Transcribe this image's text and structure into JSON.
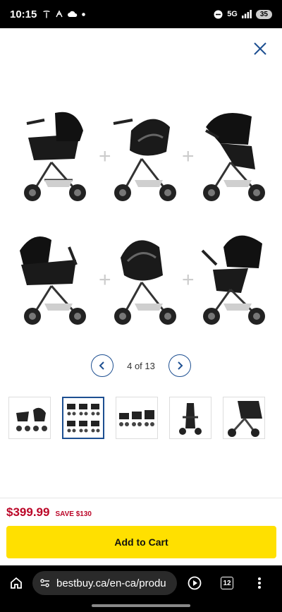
{
  "status_bar": {
    "time": "10:15",
    "signal_label": "5G",
    "battery": "35",
    "colors": {
      "bg": "#000000",
      "fg": "#ffffff"
    }
  },
  "gallery": {
    "counter": "4 of 13",
    "icons": {
      "prev": "chevron-left-icon",
      "next": "chevron-right-icon",
      "close": "close-icon"
    },
    "accent": "#1d4f91",
    "thumbnails": [
      {
        "name": "thumb-1",
        "active": false
      },
      {
        "name": "thumb-2",
        "active": true
      },
      {
        "name": "thumb-3",
        "active": false
      },
      {
        "name": "thumb-4",
        "active": false
      },
      {
        "name": "thumb-5",
        "active": false
      }
    ]
  },
  "product": {
    "price": "$399.99",
    "save": "SAVE $130",
    "add_to_cart": "Add to Cart",
    "colors": {
      "price": "#bb0628",
      "cta": "#ffe000"
    }
  },
  "browser": {
    "url": "bestbuy.ca/en-ca/produ",
    "tab_count": "12"
  }
}
